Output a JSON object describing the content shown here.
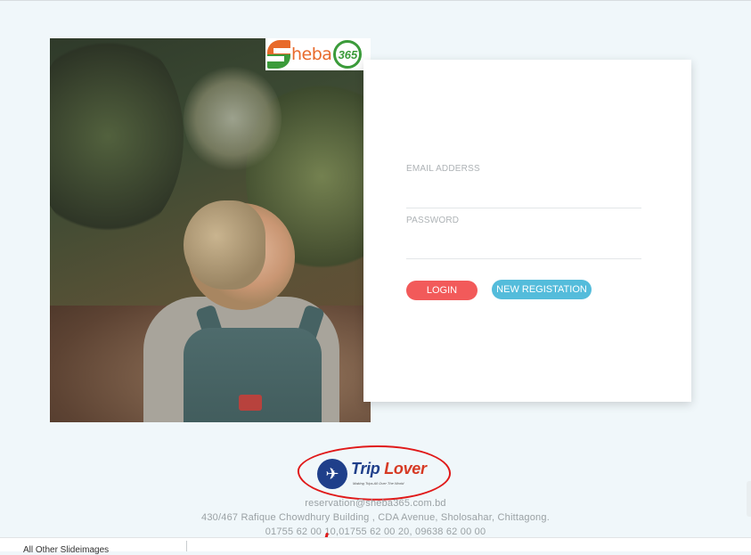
{
  "brand": {
    "logo_word": "heba",
    "logo_number": "365"
  },
  "login": {
    "email_label": "EMAIL ADDERSS",
    "email_value": "",
    "password_label": "PASSWORD",
    "password_value": "",
    "login_button": "LOGIN",
    "register_button": "NEW REGISTATION"
  },
  "partner_logo": {
    "name_part1": "Trip ",
    "name_part2": "Lover",
    "tagline": "Making Trips All Over The World"
  },
  "footer": {
    "email": "reservation@sheba365.com.bd",
    "address": "430/467 Rafique Chowdhury Building , CDA Avenue, Sholosahar, Chittagong.",
    "phones": "01755 62 00 10,01755 62 00 20, 09638 62 00 00"
  },
  "bottom_bar": {
    "text": "All Other Slideimages"
  },
  "colors": {
    "login_button": "#f25a5a",
    "register_button": "#54bcdb",
    "logo_orange": "#e86a2b",
    "logo_green": "#3b9b3a",
    "annotation_red": "#e01919"
  }
}
